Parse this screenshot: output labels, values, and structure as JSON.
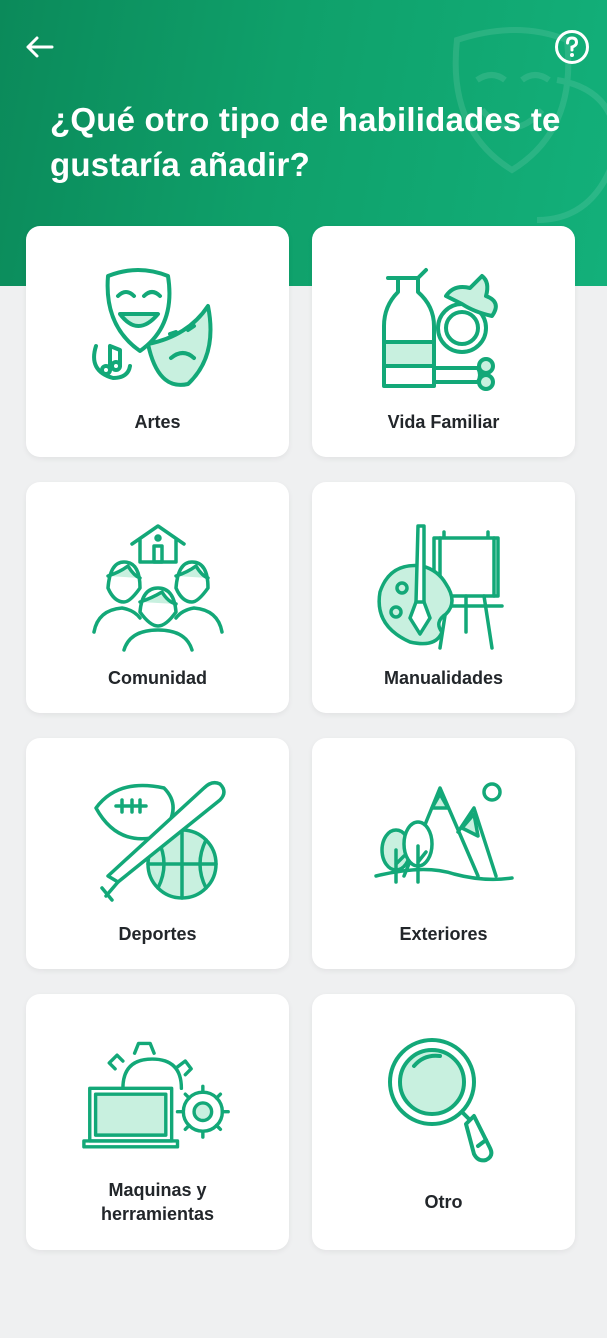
{
  "header": {
    "title": "¿Qué otro tipo de habilidades te gustaría añadir?",
    "back_icon": "arrow-left-icon",
    "help_icon": "question-circle-icon"
  },
  "colors": {
    "brand": "#0fa06a",
    "icon": "#13a878",
    "icon_fill": "#c8f0df"
  },
  "categories": [
    {
      "label": "Artes",
      "icon": "theater-masks-icon"
    },
    {
      "label": "Vida Familiar",
      "icon": "household-items-icon"
    },
    {
      "label": "Comunidad",
      "icon": "community-people-icon"
    },
    {
      "label": "Manualidades",
      "icon": "palette-easel-icon"
    },
    {
      "label": "Deportes",
      "icon": "sports-balls-icon"
    },
    {
      "label": "Exteriores",
      "icon": "mountains-trees-icon"
    },
    {
      "label": "Maquinas y herramientas",
      "icon": "laptop-gears-icon"
    },
    {
      "label": "Otro",
      "icon": "magnifier-icon"
    }
  ]
}
